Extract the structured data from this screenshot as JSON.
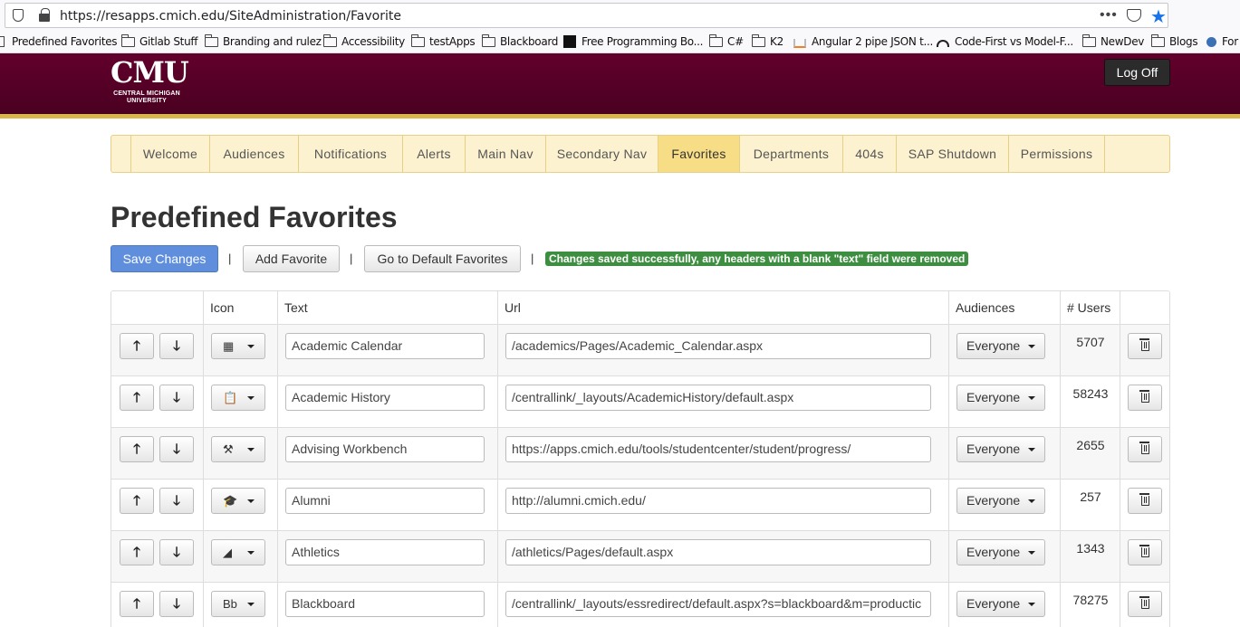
{
  "browser": {
    "url": "https://resapps.cmich.edu/SiteAdministration/Favorite",
    "menu_dots": "•••",
    "bookmarks": [
      {
        "label": "Predefined Favorites",
        "icon": "page-icon"
      },
      {
        "label": "Gitlab Stuff",
        "icon": "folder-icon"
      },
      {
        "label": "Branding and rulez",
        "icon": "folder-icon"
      },
      {
        "label": "Accessibility",
        "icon": "folder-icon"
      },
      {
        "label": "testApps",
        "icon": "folder-icon"
      },
      {
        "label": "Blackboard",
        "icon": "folder-icon"
      },
      {
        "label": "Free Programming Bo...",
        "icon": "site-icon"
      },
      {
        "label": "C#",
        "icon": "folder-icon"
      },
      {
        "label": "K2",
        "icon": "folder-icon"
      },
      {
        "label": "Angular 2 pipe JSON t...",
        "icon": "stackoverflow-icon"
      },
      {
        "label": "Code-First vs Model-F...",
        "icon": "site-icon"
      },
      {
        "label": "NewDev",
        "icon": "folder-icon"
      },
      {
        "label": "Blogs",
        "icon": "folder-icon"
      },
      {
        "label": "For",
        "icon": "site-icon"
      }
    ]
  },
  "header": {
    "logo_text": "CMU",
    "logo_sub_1": "CENTRAL MICHIGAN",
    "logo_sub_2": "UNIVERSITY",
    "logoff_label": "Log Off",
    "colors": {
      "maroon": "#62002c",
      "gold": "#d9b64a"
    }
  },
  "nav": {
    "tabs": [
      "Welcome",
      "Audiences",
      "Notifications",
      "Alerts",
      "Main Nav",
      "Secondary Nav",
      "Favorites",
      "Departments",
      "404s",
      "SAP Shutdown",
      "Permissions"
    ],
    "active": "Favorites"
  },
  "page": {
    "title": "Predefined Favorites",
    "save_label": "Save Changes",
    "add_label": "Add Favorite",
    "default_label": "Go to Default Favorites",
    "separator": "|",
    "success_message": "Changes saved successfully, any headers with a blank \"text\" field were removed"
  },
  "table": {
    "headers": {
      "icon": "Icon",
      "text": "Text",
      "url": "Url",
      "audiences": "Audiences",
      "users": "# Users"
    },
    "rows": [
      {
        "icon": "calendar-icon",
        "glyph": "▦",
        "text": "Academic Calendar",
        "url": "/academics/Pages/Academic_Calendar.aspx",
        "audience": "Everyone",
        "users": "5707"
      },
      {
        "icon": "clipboard-icon",
        "glyph": "📋",
        "text": "Academic History",
        "url": "/centrallink/_layouts/AcademicHistory/default.aspx",
        "audience": "Everyone",
        "users": "58243"
      },
      {
        "icon": "tools-icon",
        "glyph": "⚒",
        "text": "Advising Workbench",
        "url": "https://apps.cmich.edu/tools/studentcenter/student/progress/",
        "audience": "Everyone",
        "users": "2655"
      },
      {
        "icon": "graduation-cap-icon",
        "glyph": "🎓",
        "text": "Alumni",
        "url": "http://alumni.cmich.edu/",
        "audience": "Everyone",
        "users": "257"
      },
      {
        "icon": "chippewa-icon",
        "glyph": "◢",
        "text": "Athletics",
        "url": "/athletics/Pages/default.aspx",
        "audience": "Everyone",
        "users": "1343"
      },
      {
        "icon": "blackboard-icon",
        "glyph": "Bb",
        "text": "Blackboard",
        "url": "/centrallink/_layouts/essredirect/default.aspx?s=blackboard&m=productic",
        "audience": "Everyone",
        "users": "78275"
      }
    ]
  }
}
